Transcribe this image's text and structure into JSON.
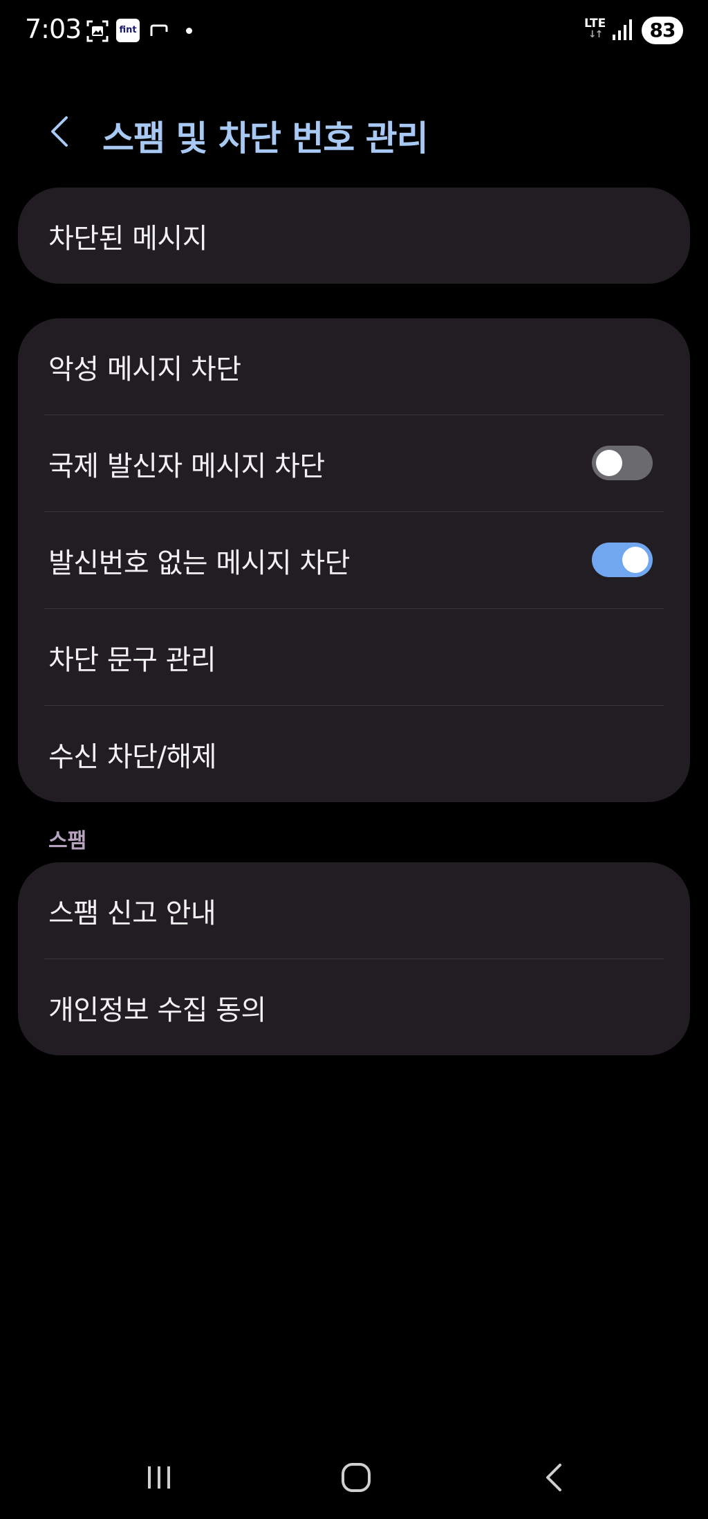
{
  "status_bar": {
    "time": "7:03",
    "fint_label": "fint",
    "network": "LTE",
    "battery": "83"
  },
  "header": {
    "title": "스팸 및 차단 번호 관리"
  },
  "card_blocked": {
    "items": [
      {
        "label": "차단된 메시지"
      }
    ]
  },
  "card_block_settings": {
    "items": [
      {
        "label": "악성 메시지 차단"
      },
      {
        "label": "국제 발신자 메시지 차단",
        "toggle": "off"
      },
      {
        "label": "발신번호 없는 메시지 차단",
        "toggle": "on"
      },
      {
        "label": "차단 문구 관리"
      },
      {
        "label": "수신 차단/해제"
      }
    ]
  },
  "spam_section": {
    "header": "스팸",
    "items": [
      {
        "label": "스팸 신고 안내"
      },
      {
        "label": "개인정보 수집 동의"
      }
    ]
  },
  "colors": {
    "background": "#000000",
    "card": "#211d23",
    "title_accent": "#a9c9f5",
    "toggle_on": "#71a7ee",
    "toggle_off": "#6b6a6f",
    "section_label": "#b7a3bf"
  },
  "icons": {
    "status": [
      "screenshot-icon",
      "fint-app-icon",
      "message-icon",
      "notification-dot-icon",
      "lte-icon",
      "signal-icon",
      "battery-icon"
    ],
    "navigation": [
      "recent-apps-icon",
      "home-icon",
      "back-icon"
    ]
  }
}
